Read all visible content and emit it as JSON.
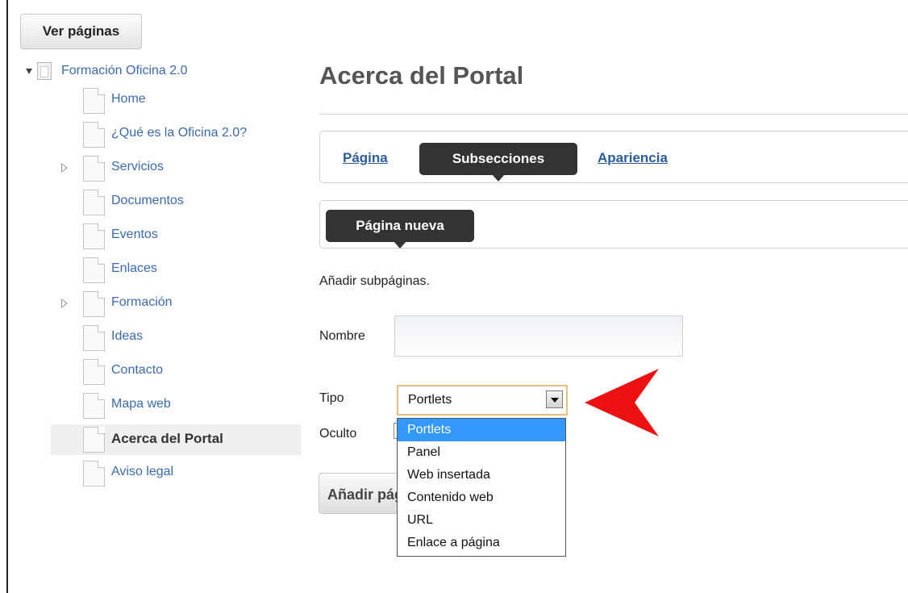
{
  "header": {
    "view_pages_label": "Ver páginas"
  },
  "tree": {
    "root": "Formación Oficina 2.0",
    "items": [
      {
        "label": "Home",
        "expandable": false,
        "selected": false
      },
      {
        "label": "¿Qué es la Oficina 2.0?",
        "expandable": false,
        "selected": false
      },
      {
        "label": "Servicios",
        "expandable": true,
        "selected": false
      },
      {
        "label": "Documentos",
        "expandable": false,
        "selected": false
      },
      {
        "label": "Eventos",
        "expandable": false,
        "selected": false
      },
      {
        "label": "Enlaces",
        "expandable": false,
        "selected": false
      },
      {
        "label": "Formación",
        "expandable": true,
        "selected": false
      },
      {
        "label": "Ideas",
        "expandable": false,
        "selected": false
      },
      {
        "label": "Contacto",
        "expandable": false,
        "selected": false
      },
      {
        "label": "Mapa web",
        "expandable": false,
        "selected": false
      },
      {
        "label": "Acerca del Portal",
        "expandable": false,
        "selected": true
      },
      {
        "label": "Aviso legal",
        "expandable": false,
        "selected": false
      }
    ]
  },
  "main": {
    "title": "Acerca del Portal",
    "tabs": {
      "pagina": "Página",
      "subsecciones": "Subsecciones",
      "apariencia": "Apariencia"
    },
    "subtab": "Página nueva",
    "description": "Añadir subpáginas.",
    "form": {
      "nombre_label": "Nombre",
      "nombre_value": "",
      "tipo_label": "Tipo",
      "tipo_value": "Portlets",
      "oculto_label": "Oculto",
      "add_button": "Añadir página"
    },
    "tipo_options": [
      "Portlets",
      "Panel",
      "Web insertada",
      "Contenido web",
      "URL",
      "Enlace a página"
    ]
  },
  "colors": {
    "link": "#3c6ab0",
    "pill_bg": "#333333",
    "highlight": "#3399ff",
    "arrow": "#ee1111"
  }
}
